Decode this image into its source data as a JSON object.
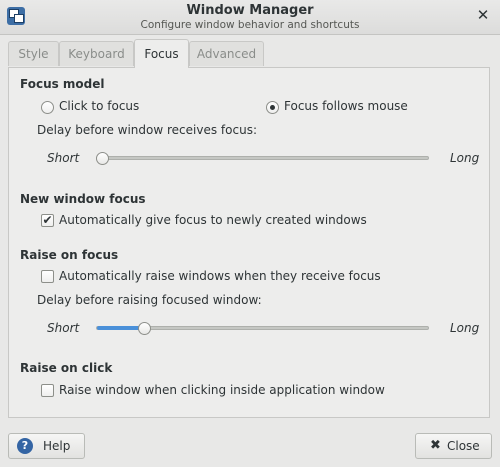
{
  "window": {
    "title": "Window Manager",
    "subtitle": "Configure window behavior and shortcuts",
    "close_glyph": "✕"
  },
  "tabs": [
    {
      "label": "Style",
      "active": false
    },
    {
      "label": "Keyboard",
      "active": false
    },
    {
      "label": "Focus",
      "active": true
    },
    {
      "label": "Advanced",
      "active": false
    }
  ],
  "focus_model": {
    "title": "Focus model",
    "option_click": "Click to focus",
    "option_follow": "Focus follows mouse",
    "selected": "Focus follows mouse",
    "delay_label": "Delay before window receives focus:",
    "slider_min": "Short",
    "slider_max": "Long",
    "slider_value": 0.0
  },
  "new_window_focus": {
    "title": "New window focus",
    "checkbox_label": "Automatically give focus to newly created windows",
    "checked": true,
    "check_glyph": "✔"
  },
  "raise_on_focus": {
    "title": "Raise on focus",
    "checkbox_label": "Automatically raise windows when they receive focus",
    "checked": false,
    "delay_label": "Delay before raising focused window:",
    "slider_min": "Short",
    "slider_max": "Long",
    "slider_value": 0.13
  },
  "raise_on_click": {
    "title": "Raise on click",
    "checkbox_label": "Raise window when clicking inside application window",
    "checked": false
  },
  "footer": {
    "help_label": "Help",
    "help_glyph": "?",
    "close_label": "Close",
    "close_glyph": "✖"
  },
  "icons": [
    "window-manager-app-icon",
    "close-icon",
    "help-icon",
    "close-button-icon",
    "checkmark-icon"
  ],
  "colors": {
    "accent": "#4a90d9",
    "help_icon": "#3465a4",
    "background": "#e8e8e7"
  }
}
